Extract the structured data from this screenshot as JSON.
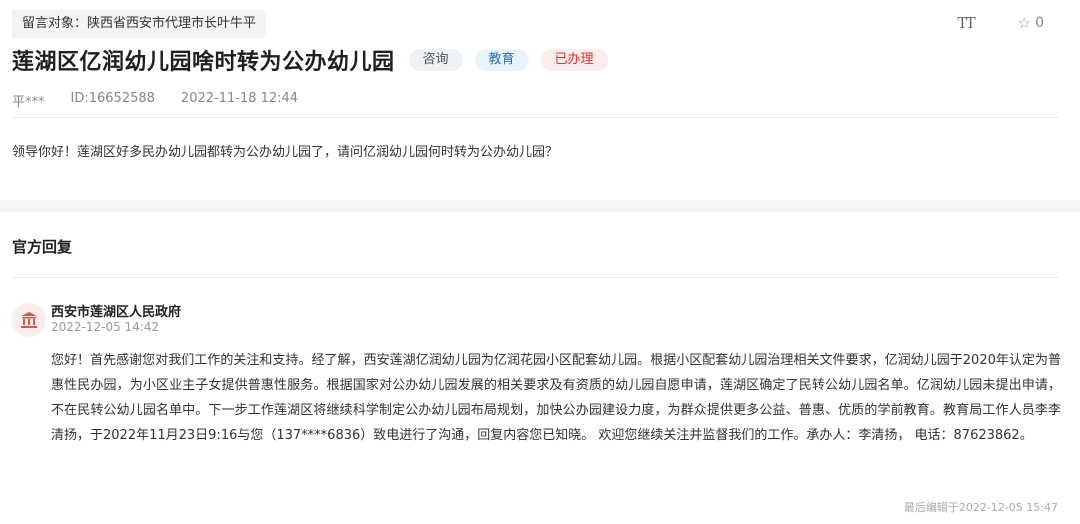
{
  "message": {
    "target_label": "留言对象：陕西省西安市代理市长叶牛平",
    "title": "莲湖区亿润幼儿园啥时转为公办幼儿园",
    "tags": [
      "咨询",
      "教育",
      "已办理"
    ],
    "author": "平***",
    "id_text": "ID:16652588",
    "datetime": "2022-11-18 12:44",
    "content": "领导你好！莲湖区好多民办幼儿园都转为公办幼儿园了，请问亿润幼儿园何时转为公办幼儿园？",
    "favorite_count": "0"
  },
  "toolbar": {
    "font_size_icon": "TT",
    "star_icon": "☆"
  },
  "reply": {
    "section_title": "官方回复",
    "org_name": "西安市莲湖区人民政府",
    "org_date": "2022-12-05 14:42",
    "body": "您好！首先感谢您对我们工作的关注和支持。经了解，西安莲湖亿润幼儿园为亿润花园小区配套幼儿园。根据小区配套幼儿园治理相关文件要求，亿润幼儿园于2020年认定为普惠性民办园，为小区业主子女提供普惠性服务。根据国家对公办幼儿园发展的相关要求及有资质的幼儿园自愿申请，莲湖区确定了民转公幼儿园名单。亿润幼儿园未提出申请，不在民转公幼儿园名单中。下一步工作莲湖区将继续科学制定公办幼儿园布局规划，加快公办园建设力度，为群众提供更多公益、普惠、优质的学前教育。教育局工作人员李李清扬，于2022年11月23日9:16与您（137****6836）致电进行了沟通，回复内容您已知晓。 欢迎您继续关注并监督我们的工作。承办人：李清扬， 电话：87623862。",
    "last_edit": "最后编辑于2022-12-05 15:47"
  },
  "colors": {
    "tag_consult_bg": "#eef1f5",
    "tag_edu_bg": "#e8f3fb",
    "tag_done_bg": "#fdecec",
    "tag_done_text": "#dd3333",
    "avatar_icon": "#d9534f"
  }
}
